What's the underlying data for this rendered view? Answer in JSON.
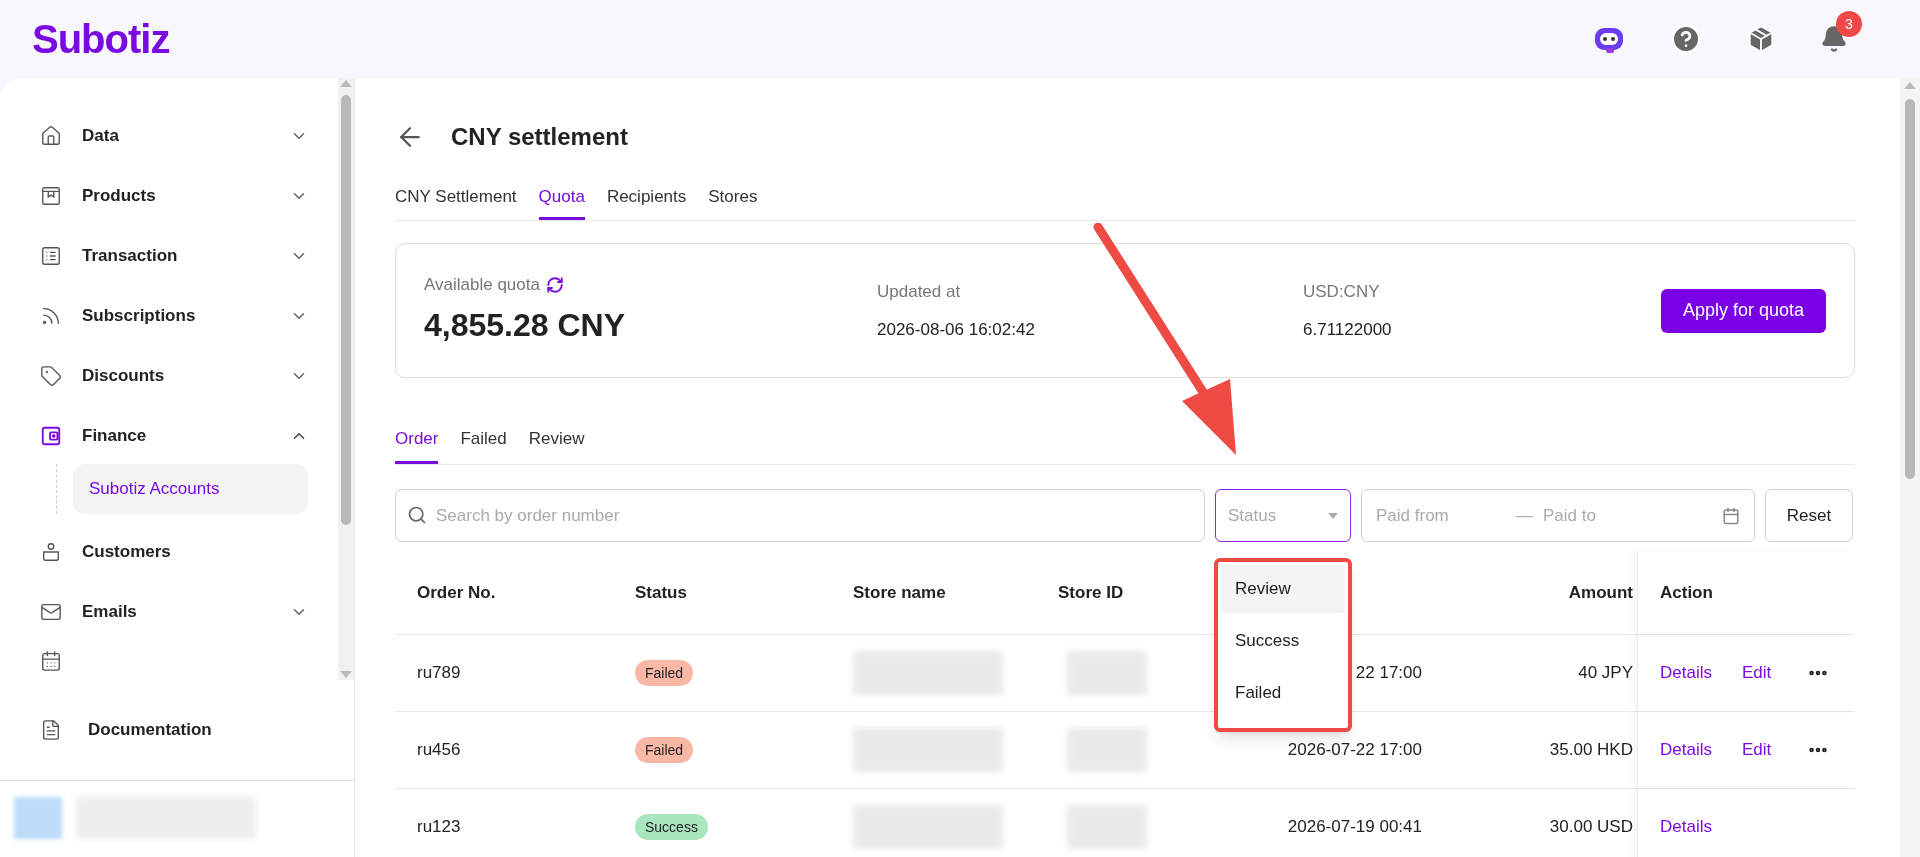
{
  "header": {
    "logo": "Subotiz",
    "notification_count": "3"
  },
  "sidebar": {
    "items": [
      {
        "label": "Data",
        "kind": "home",
        "expandable": true,
        "expanded": false
      },
      {
        "label": "Products",
        "kind": "product",
        "expandable": true,
        "expanded": false
      },
      {
        "label": "Transaction",
        "kind": "list",
        "expandable": true,
        "expanded": false
      },
      {
        "label": "Subscriptions",
        "kind": "feed",
        "expandable": true,
        "expanded": false
      },
      {
        "label": "Discounts",
        "kind": "tag",
        "expandable": true,
        "expanded": false
      },
      {
        "label": "Finance",
        "kind": "wallet",
        "expandable": true,
        "expanded": true,
        "children": [
          {
            "label": "Subotiz Accounts",
            "selected": true
          }
        ]
      },
      {
        "label": "Customers",
        "kind": "person",
        "expandable": false,
        "expanded": false
      },
      {
        "label": "Emails",
        "kind": "mail",
        "expandable": true,
        "expanded": false
      }
    ],
    "footer_link": "Documentation"
  },
  "page": {
    "title": "CNY settlement",
    "tabs": [
      {
        "label": "CNY Settlement",
        "selected": false
      },
      {
        "label": "Quota",
        "selected": true
      },
      {
        "label": "Recipients",
        "selected": false
      },
      {
        "label": "Stores",
        "selected": false
      }
    ],
    "quota": {
      "label": "Available quota",
      "value": "4,855.28 CNY",
      "updated_label": "Updated at",
      "updated_value": "2026-08-06 16:02:42",
      "rate_label": "USD:CNY",
      "rate_value": "6.71122000",
      "button": "Apply for quota"
    },
    "sub_tabs": [
      {
        "label": "Order",
        "selected": true
      },
      {
        "label": "Failed",
        "selected": false
      },
      {
        "label": "Review",
        "selected": false
      }
    ],
    "filters": {
      "search_placeholder": "Search by order number",
      "status_placeholder": "Status",
      "status_open": true,
      "paid_from_placeholder": "Paid from",
      "separator": "—",
      "paid_to_placeholder": "Paid to",
      "reset": "Reset"
    },
    "status_options": [
      {
        "label": "Review",
        "highlighted": true
      },
      {
        "label": "Success",
        "highlighted": false
      },
      {
        "label": "Failed",
        "highlighted": false
      }
    ],
    "table": {
      "columns": [
        "Order No.",
        "Status",
        "Store name",
        "Store ID",
        "Amount",
        "Action"
      ],
      "rows": [
        {
          "order": "ru789",
          "status": "Failed",
          "color": "#f9b7a6",
          "paid_at": "22 17:00",
          "amount": "40 JPY",
          "actions": [
            "Details",
            "Edit"
          ],
          "more": true
        },
        {
          "order": "ru456",
          "status": "Failed",
          "color": "#f9b7a6",
          "paid_at": "2026-07-22 17:00",
          "amount": "35.00 HKD",
          "actions": [
            "Details",
            "Edit"
          ],
          "more": true
        },
        {
          "order": "ru123",
          "status": "Success",
          "color": "#a9e5bf",
          "paid_at": "2026-07-19 00:41",
          "amount": "30.00 USD",
          "actions": [
            "Details"
          ],
          "more": false
        }
      ]
    }
  }
}
